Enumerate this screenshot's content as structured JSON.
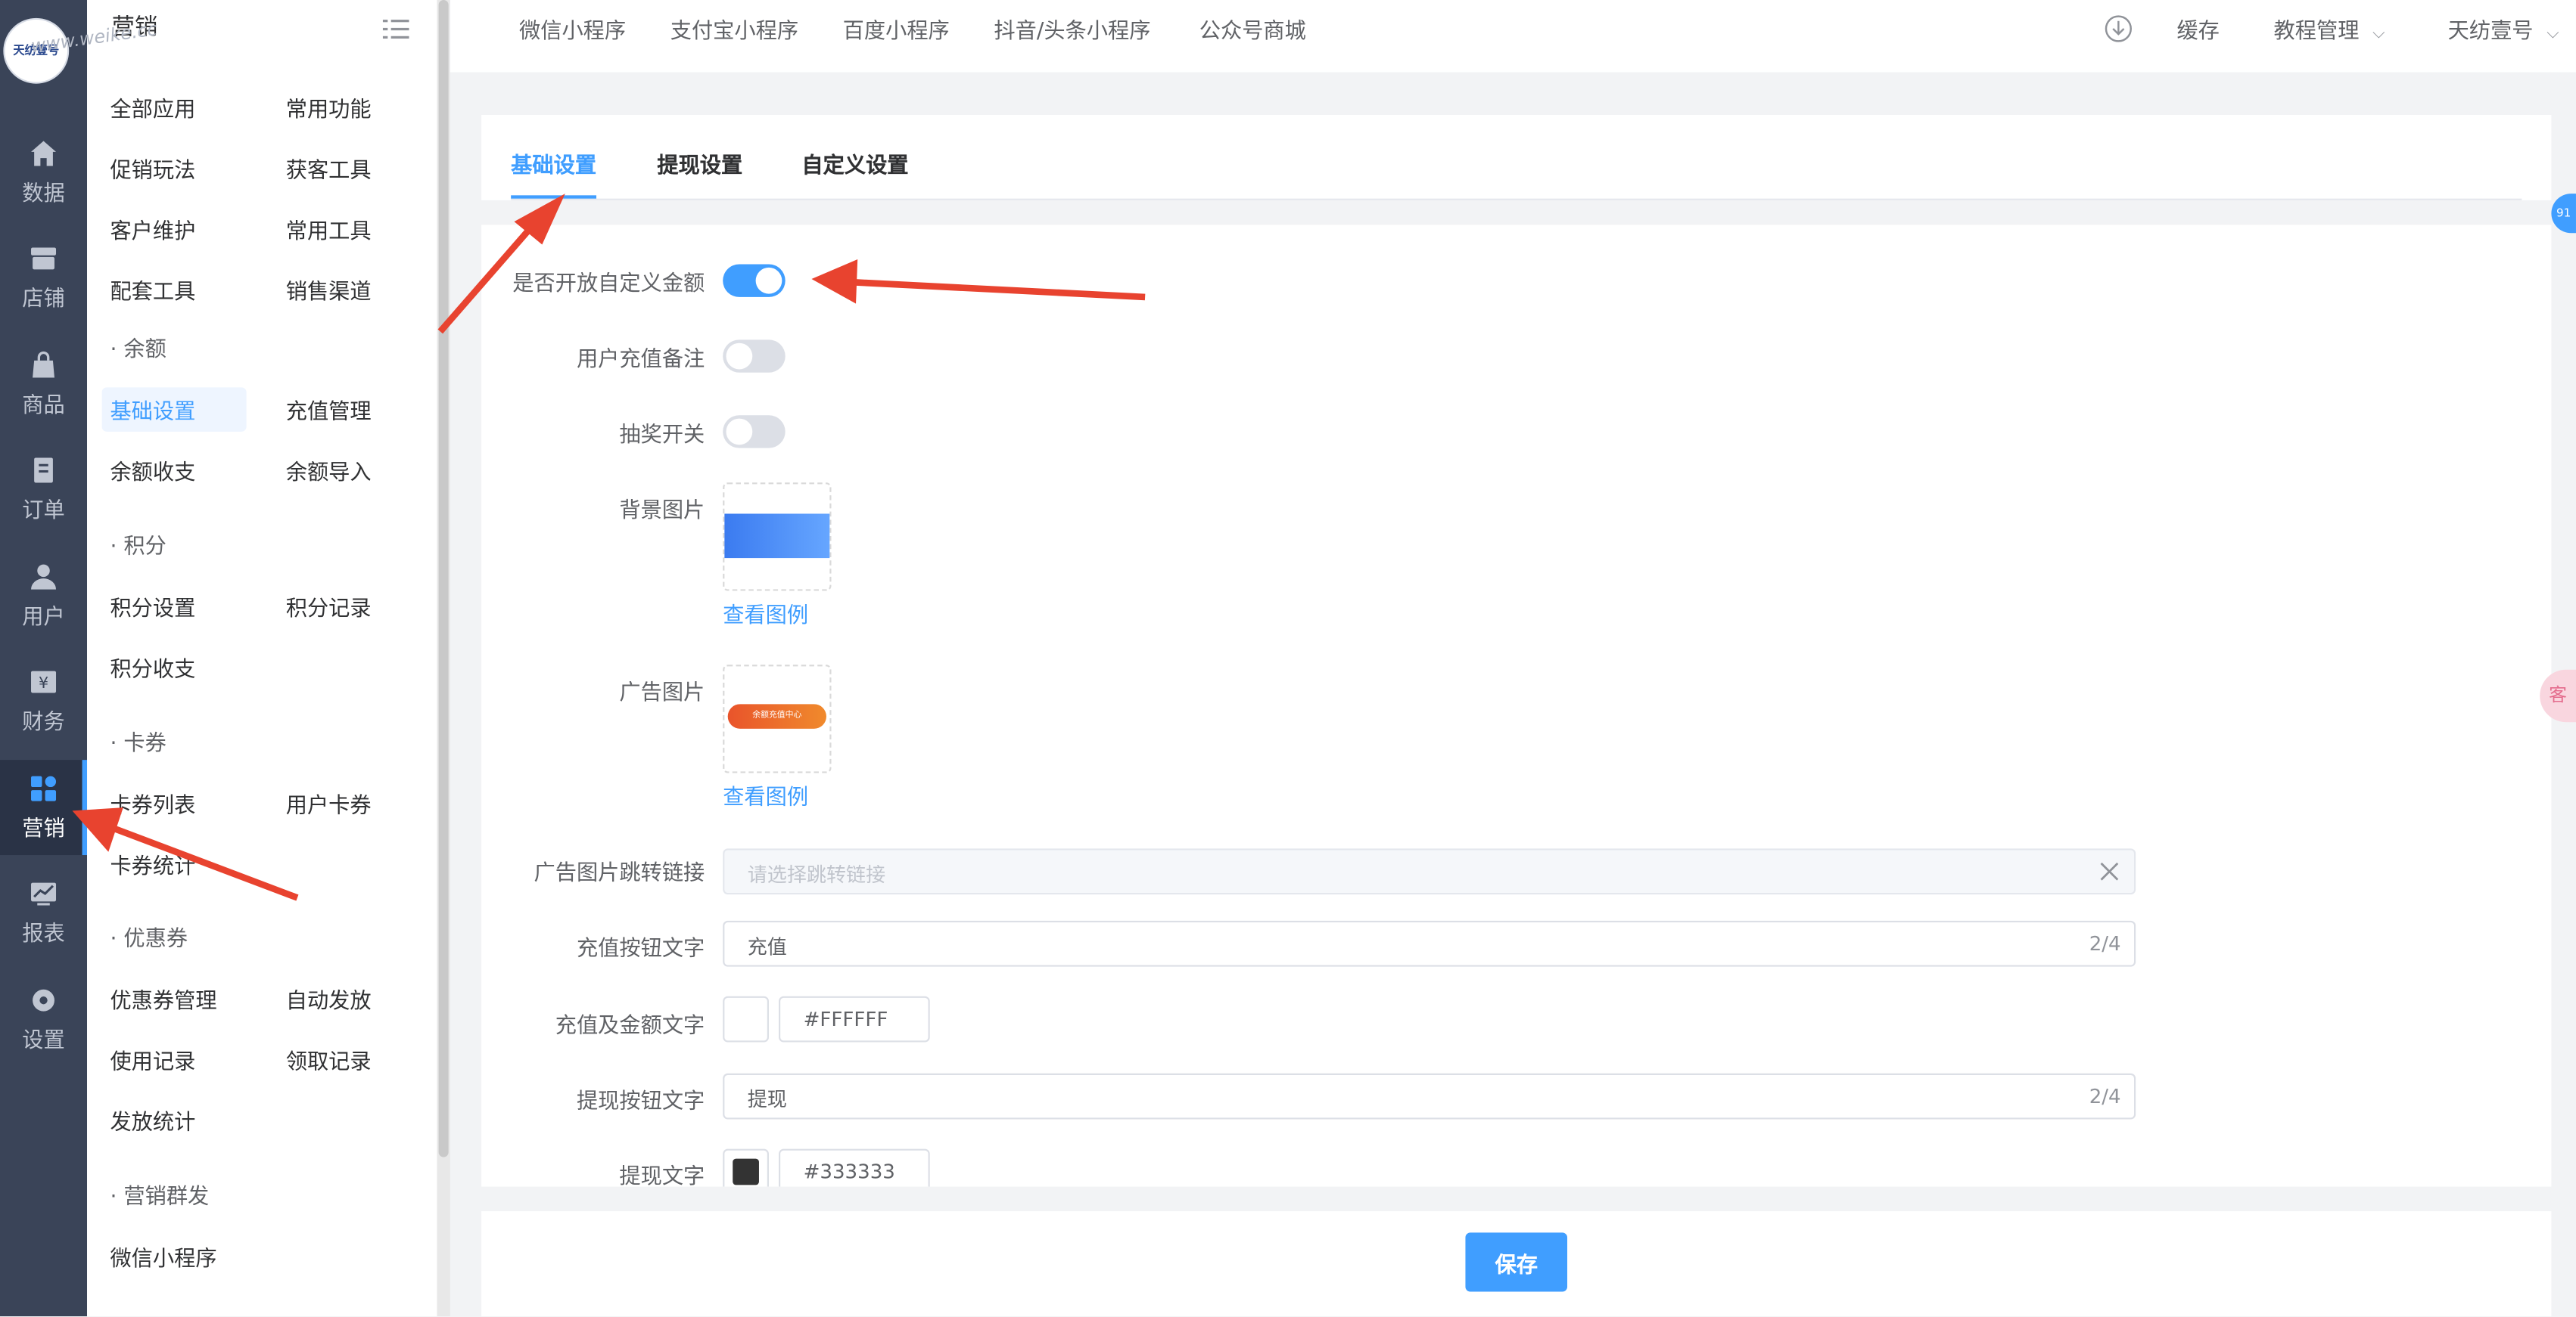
{
  "colors": {
    "accent": "#409eff",
    "rail": "#3a4458",
    "annotation": "#e8432f"
  },
  "watermark": "www.weike.cc",
  "logo_text": "天纺壹号",
  "rail": [
    {
      "label": "数据",
      "icon": "home-icon"
    },
    {
      "label": "店铺",
      "icon": "store-icon"
    },
    {
      "label": "商品",
      "icon": "bag-icon"
    },
    {
      "label": "订单",
      "icon": "order-icon"
    },
    {
      "label": "用户",
      "icon": "user-icon"
    },
    {
      "label": "财务",
      "icon": "yen-icon"
    },
    {
      "label": "营销",
      "icon": "apps-icon",
      "active": true
    },
    {
      "label": "报表",
      "icon": "chart-icon"
    },
    {
      "label": "设置",
      "icon": "gear-icon"
    }
  ],
  "submenu": {
    "title": "营销",
    "items": {
      "all_apps": "全部应用",
      "common_functions": "常用功能",
      "promotion": "促销玩法",
      "acquisition": "获客工具",
      "customer": "客户维护",
      "common_tools": "常用工具",
      "support": "配套工具",
      "sales_channel": "销售渠道",
      "balance_group": "· 余额",
      "basic_settings": "基础设置",
      "recharge_mgmt": "充值管理",
      "balance_flow": "余额收支",
      "balance_import": "余额导入",
      "points_group": "· 积分",
      "points_settings": "积分设置",
      "points_record": "积分记录",
      "points_flow": "积分收支",
      "cards_group": "· 卡券",
      "card_list": "卡券列表",
      "user_cards": "用户卡券",
      "card_stats": "卡券统计",
      "coupon_group": "· 优惠券",
      "coupon_mgmt": "优惠券管理",
      "auto_issue": "自动发放",
      "usage_record": "使用记录",
      "claim_record": "领取记录",
      "issue_stats": "发放统计",
      "mass_group": "· 营销群发",
      "wechat_mini": "微信小程序"
    }
  },
  "topnav": {
    "items": [
      "微信小程序",
      "支付宝小程序",
      "百度小程序",
      "抖音/头条小程序",
      "公众号商城"
    ],
    "cache": "缓存",
    "tutorial": "教程管理",
    "account": "天纺壹号"
  },
  "tabs": [
    "基础设置",
    "提现设置",
    "自定义设置"
  ],
  "form": {
    "custom_amount_label": "是否开放自定义金额",
    "custom_amount_on": true,
    "recharge_note_label": "用户充值备注",
    "recharge_note_on": false,
    "lottery_label": "抽奖开关",
    "lottery_on": false,
    "bg_image_label": "背景图片",
    "view_example": "查看图例",
    "ad_image_label": "广告图片",
    "ad_banner_text": "余额充值中心",
    "ad_link_label": "广告图片跳转链接",
    "ad_link_placeholder": "请选择跳转链接",
    "recharge_btn_label": "充值按钮文字",
    "recharge_btn_value": "充值",
    "recharge_btn_count": "2/4",
    "recharge_color_label": "充值及金额文字",
    "recharge_color_value": "#FFFFFF",
    "withdraw_btn_label": "提现按钮文字",
    "withdraw_btn_value": "提现",
    "withdraw_btn_count": "2/4",
    "withdraw_color_label": "提现文字",
    "withdraw_color_value": "#333333"
  },
  "save_label": "保存",
  "float_badge": "91",
  "float_pink": "客"
}
